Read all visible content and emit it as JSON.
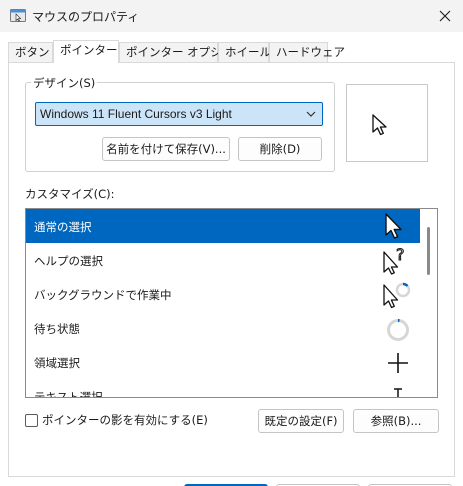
{
  "window": {
    "title": "マウスのプロパティ"
  },
  "tabs": [
    {
      "label": "ボタン"
    },
    {
      "label": "ポインター"
    },
    {
      "label": "ポインター オプション"
    },
    {
      "label": "ホイール"
    },
    {
      "label": "ハードウェア"
    }
  ],
  "design": {
    "legend": "デザイン(S)",
    "scheme_value": "Windows 11 Fluent Cursors v3 Light",
    "save_as_label": "名前を付けて保存(V)...",
    "delete_label": "削除(D)"
  },
  "customize": {
    "label": "カスタマイズ(C):",
    "items": [
      {
        "label": "通常の選択",
        "icon": "arrow-cursor-icon"
      },
      {
        "label": "ヘルプの選択",
        "icon": "help-cursor-icon"
      },
      {
        "label": "バックグラウンドで作業中",
        "icon": "working-in-background-cursor-icon"
      },
      {
        "label": "待ち状態",
        "icon": "busy-cursor-icon"
      },
      {
        "label": "領域選択",
        "icon": "precision-cursor-icon"
      },
      {
        "label": "テキスト選択",
        "icon": "text-cursor-icon"
      }
    ]
  },
  "shadow_checkbox": {
    "label": "ポインターの影を有効にする(E)",
    "checked": false
  },
  "buttons": {
    "default_label": "既定の設定(F)",
    "browse_label": "参照(B)..."
  },
  "colors": {
    "accent": "#0067c0",
    "select_bg": "#cce4f7"
  }
}
